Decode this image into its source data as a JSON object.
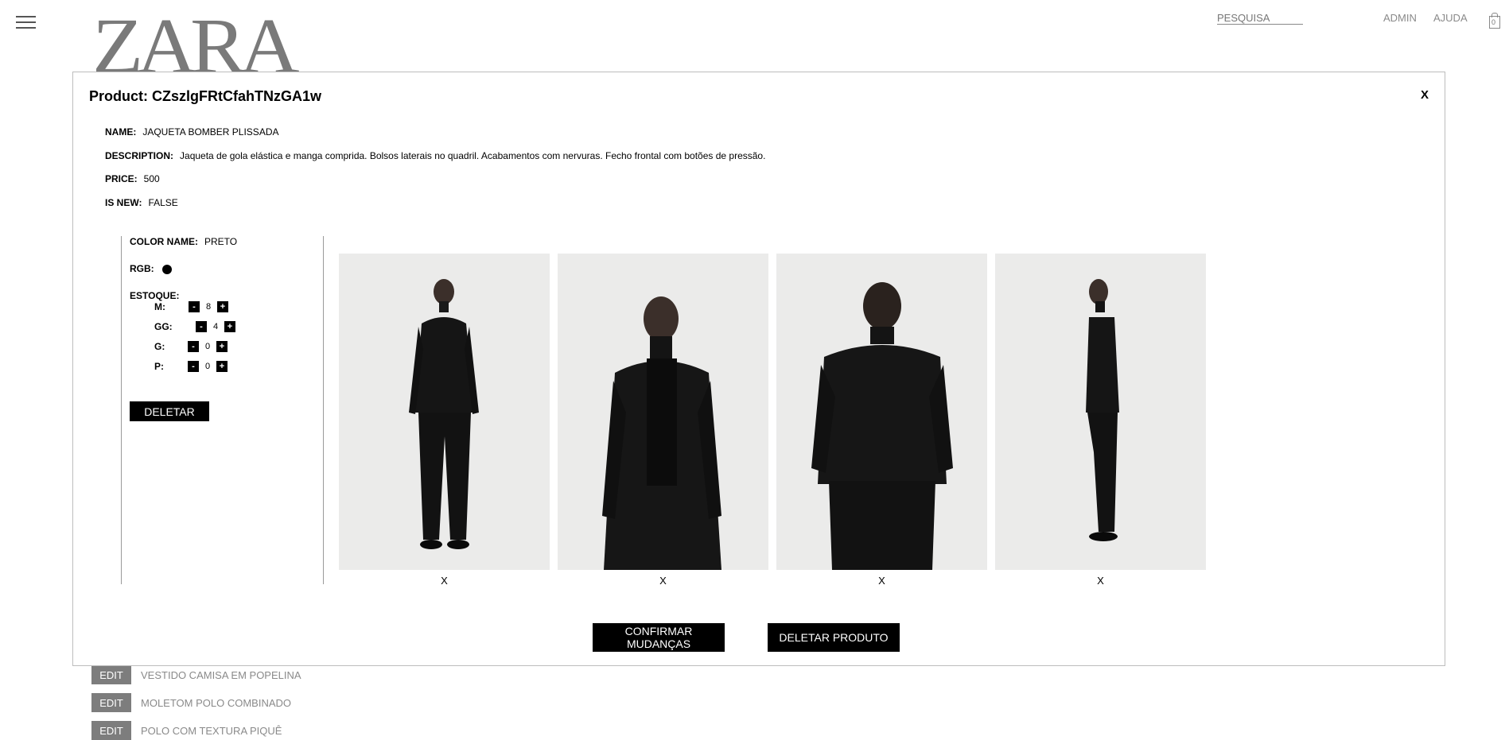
{
  "header": {
    "logo": "ZARA",
    "search_placeholder": "PESQUISA",
    "admin_label": "ADMIN",
    "help_label": "AJUDA",
    "cart_count": "0"
  },
  "background_list": [
    {
      "edit_label": "EDIT",
      "name": "VESTIDO CAMISA EM POPELINA"
    },
    {
      "edit_label": "EDIT",
      "name": "MOLETOM POLO COMBINADO"
    },
    {
      "edit_label": "EDIT",
      "name": "POLO COM TEXTURA PIQUÊ"
    }
  ],
  "modal": {
    "title": "Product: CZszlgFRtCfahTNzGA1w",
    "close_label": "X",
    "fields": {
      "name_label": "NAME:",
      "name_value": "JAQUETA BOMBER PLISSADA",
      "description_label": "DESCRIPTION:",
      "description_value": "Jaqueta de gola elástica e manga comprida. Bolsos laterais no quadril. Acabamentos com nervuras. Fecho frontal com botões de pressão.",
      "price_label": "PRICE:",
      "price_value": "500",
      "is_new_label": "IS NEW:",
      "is_new_value": "FALSE"
    },
    "variant": {
      "color_name_label": "COLOR NAME:",
      "color_name_value": "PRETO",
      "rgb_label": "RGB:",
      "rgb_color": "#000000",
      "stock_label": "ESTOQUE:",
      "stock": [
        {
          "size": "M:",
          "qty": "8"
        },
        {
          "size": "GG:",
          "qty": "4"
        },
        {
          "size": "G:",
          "qty": "0"
        },
        {
          "size": "P:",
          "qty": "0"
        }
      ],
      "minus_label": "-",
      "plus_label": "+",
      "delete_label": "DELETAR",
      "images": [
        {
          "view": "front-full",
          "remove_label": "X"
        },
        {
          "view": "front-close",
          "remove_label": "X"
        },
        {
          "view": "back",
          "remove_label": "X"
        },
        {
          "view": "side",
          "remove_label": "X"
        }
      ]
    },
    "confirm_label": "CONFIRMAR MUDANÇAS",
    "delete_product_label": "DELETAR PRODUTO"
  },
  "colors": {
    "accent": "#000000",
    "muted_text": "#8a8a8a",
    "edit_button_bg": "#7d7d7d"
  }
}
